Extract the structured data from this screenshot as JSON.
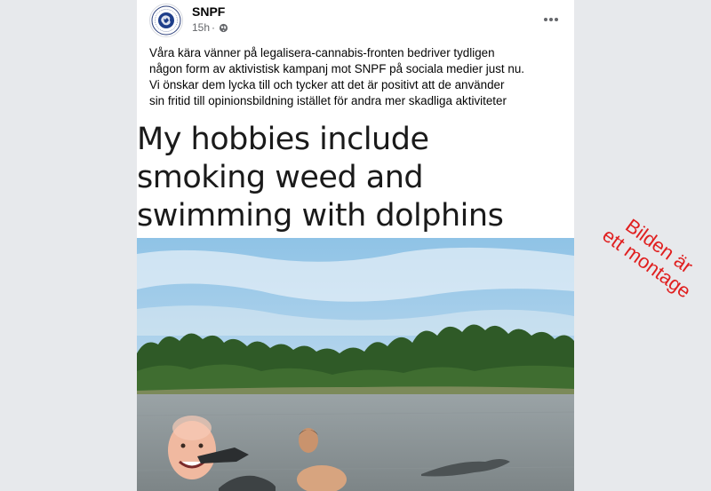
{
  "post": {
    "author": "SNPF",
    "timestamp": "15h",
    "separator": "·",
    "privacy_icon": "globe-icon",
    "more_icon": "more-horizontal-icon",
    "text": "Våra kära vänner på legalisera-cannabis-fronten bedriver tydligen\nnågon form av aktivistisk kampanj mot SNPF på sociala medier just nu.\nVi önskar dem lycka till och tycker att det är positivt att de använder\nsin fritid till opinionsbildning istället för andra mer skadliga aktiviteter"
  },
  "meme": {
    "caption": "My hobbies include\nsmoking weed and\nswimming with dolphins"
  },
  "overlay": {
    "text": "Bilden är\nett montage",
    "color": "#e02020"
  }
}
